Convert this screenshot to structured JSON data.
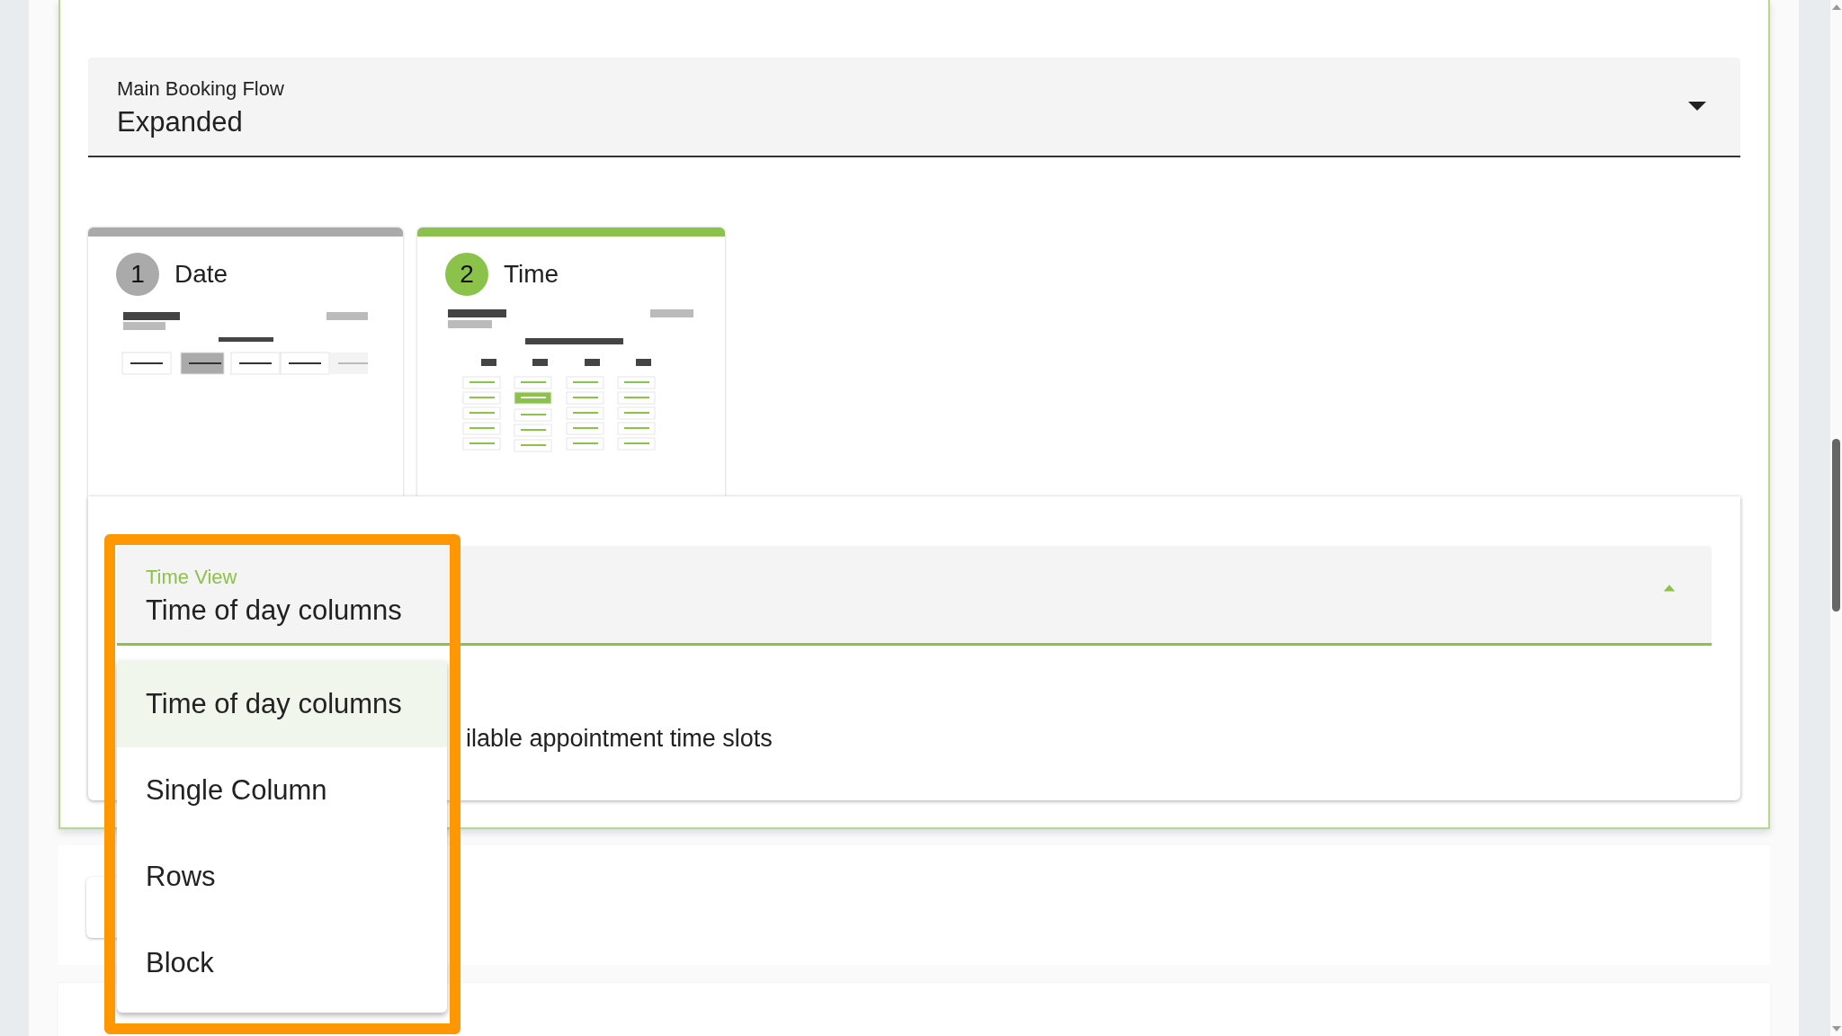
{
  "booking_flow": {
    "label": "Main Booking Flow",
    "value": "Expanded",
    "open": false
  },
  "steps": [
    {
      "number": "1",
      "label": "Date",
      "selected": false,
      "kind": "date"
    },
    {
      "number": "2",
      "label": "Time",
      "selected": true,
      "kind": "time"
    }
  ],
  "time_view": {
    "label": "Time View",
    "value": "Time of day columns",
    "open": true,
    "highlighted": true
  },
  "description": "ilable appointment time slots",
  "menu": [
    {
      "label": "Time of day columns",
      "selected": true
    },
    {
      "label": "Single Column",
      "selected": false
    },
    {
      "label": "Rows",
      "selected": false
    },
    {
      "label": "Block",
      "selected": false
    }
  ]
}
